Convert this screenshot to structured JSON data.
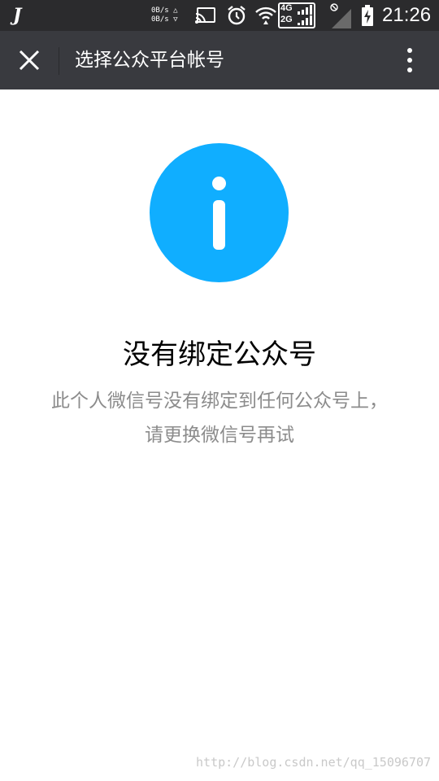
{
  "status_bar": {
    "app_icon_text": "J",
    "net_speed_up": "0B/s △",
    "net_speed_down": "0B/s ▽",
    "network_primary": "4G",
    "network_secondary": "2G",
    "time": "21:26"
  },
  "toolbar": {
    "title": "选择公众平台帐号"
  },
  "main": {
    "icon": "info-icon",
    "icon_color": "#10aeff",
    "title": "没有绑定公众号",
    "description_line1": "此个人微信号没有绑定到任何公众号上，",
    "description_line2": "请更换微信号再试"
  },
  "watermark": "http://blog.csdn.net/qq_15096707"
}
